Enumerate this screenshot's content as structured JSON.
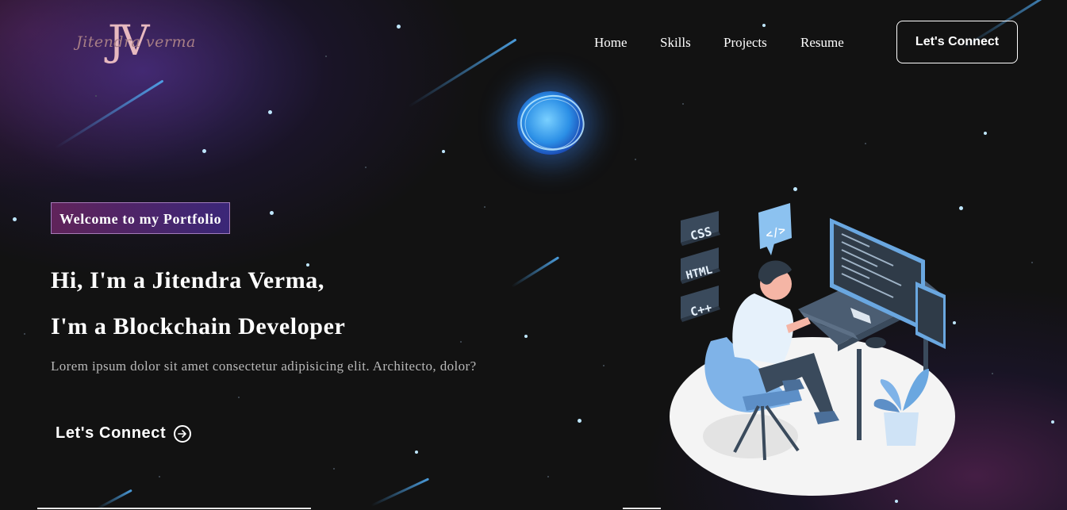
{
  "brand": {
    "monogram": "JV",
    "signature": "Jitendra verma"
  },
  "nav": {
    "items": [
      "Home",
      "Skills",
      "Projects",
      "Resume"
    ],
    "cta_label": "Let's Connect"
  },
  "hero": {
    "tagline": "Welcome to my Portfolio",
    "heading_line1": "Hi, I'm a Jitendra Verma,",
    "heading_line2": "I'm a Blockchain Developer",
    "description": "Lorem ipsum dolor sit amet consectetur adipisicing elit. Architecto, dolor?",
    "cta_label": "Let's Connect"
  },
  "illustration": {
    "badges": [
      "CSS",
      "HTML",
      "C++"
    ],
    "code_icon": "</>"
  },
  "colors": {
    "background": "#121212",
    "accent_purple": "#4a2f8c",
    "accent_blue": "#2b8fe6",
    "illustration_blue": "#6aa7e0"
  }
}
